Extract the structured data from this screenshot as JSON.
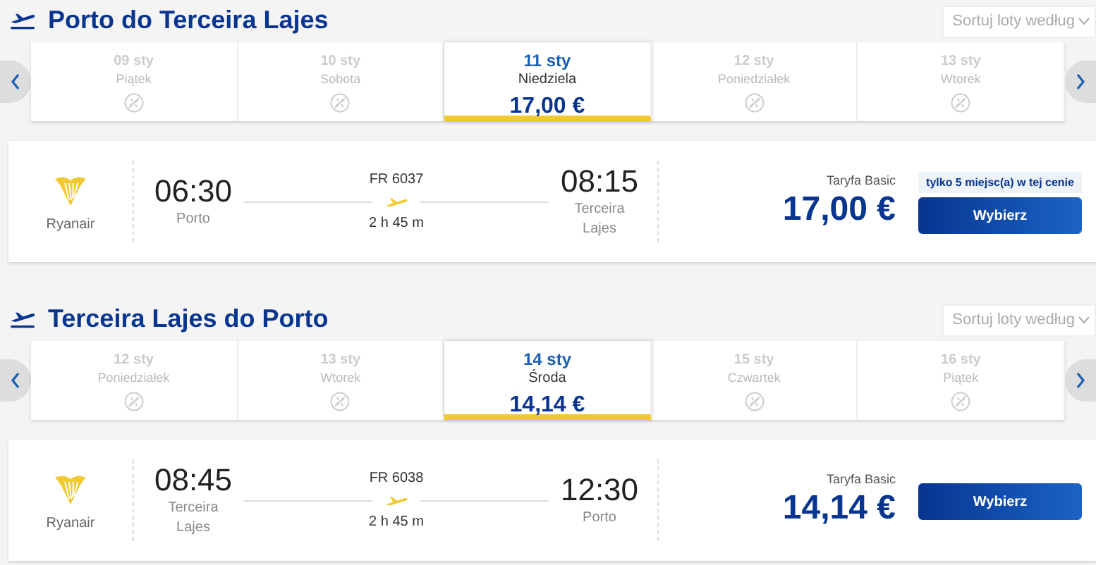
{
  "legs": [
    {
      "title": "Porto do Terceira Lajes",
      "sort": {
        "label": "Sortuj loty według"
      },
      "dates": [
        {
          "date": "09 sty",
          "day": "Piątek",
          "selected": false
        },
        {
          "date": "10 sty",
          "day": "Sobota",
          "selected": false
        },
        {
          "date": "11 sty",
          "day": "Niedziela",
          "price": "17,00 €",
          "selected": true
        },
        {
          "date": "12 sty",
          "day": "Poniedziałek",
          "selected": false
        },
        {
          "date": "13 sty",
          "day": "Wtorek",
          "selected": false
        }
      ],
      "flight": {
        "airline": "Ryanair",
        "depart_time": "06:30",
        "depart_city": "Porto",
        "number": "FR 6037",
        "duration": "2 h 45 m",
        "arrive_time": "08:15",
        "arrive_city": "Terceira Lajes",
        "fare": "Taryfa Basic",
        "price": "17,00 €",
        "badge": "tylko 5 miejsc(a) w tej cenie",
        "button": "Wybierz"
      }
    },
    {
      "title": "Terceira Lajes do Porto",
      "sort": {
        "label": "Sortuj loty według"
      },
      "dates": [
        {
          "date": "12 sty",
          "day": "Poniedziałek",
          "selected": false
        },
        {
          "date": "13 sty",
          "day": "Wtorek",
          "selected": false
        },
        {
          "date": "14 sty",
          "day": "Środa",
          "price": "14,14 €",
          "selected": true
        },
        {
          "date": "15 sty",
          "day": "Czwartek",
          "selected": false
        },
        {
          "date": "16 sty",
          "day": "Piątek",
          "selected": false
        }
      ],
      "flight": {
        "airline": "Ryanair",
        "depart_time": "08:45",
        "depart_city": "Terceira Lajes",
        "number": "FR 6038",
        "duration": "2 h 45 m",
        "arrive_time": "12:30",
        "arrive_city": "Porto",
        "fare": "Taryfa Basic",
        "price": "14,14 €",
        "button": "Wybierz"
      }
    }
  ]
}
